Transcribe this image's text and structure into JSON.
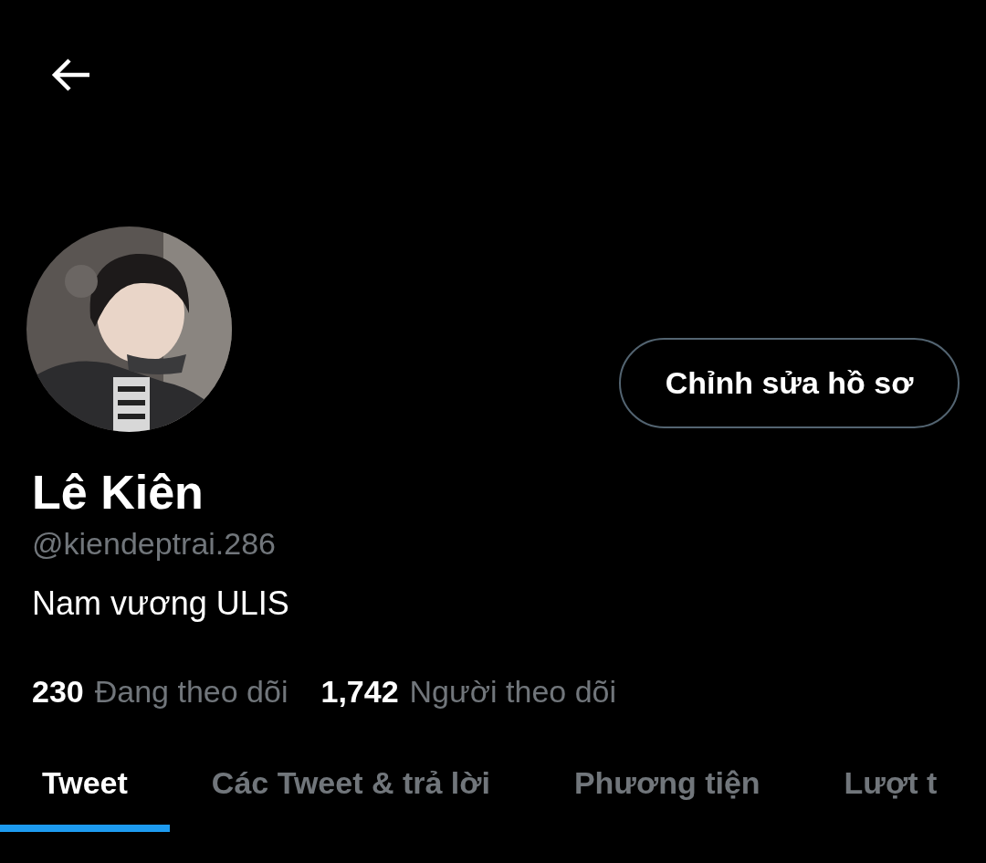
{
  "profile": {
    "edit_button": "Chỉnh sửa hồ sơ",
    "name": "Lê Kiên",
    "handle": "@kiendeptrai.286",
    "bio": "Nam vương ULIS",
    "stats": [
      {
        "count": "230",
        "label": "Đang theo dõi"
      },
      {
        "count": "1,742",
        "label": "Người theo dõi"
      }
    ]
  },
  "tabs": [
    {
      "label": "Tweet",
      "selected": true
    },
    {
      "label": "Các Tweet & trả lời",
      "selected": false
    },
    {
      "label": "Phương tiện",
      "selected": false
    },
    {
      "label": "Lượt t",
      "selected": false
    }
  ]
}
